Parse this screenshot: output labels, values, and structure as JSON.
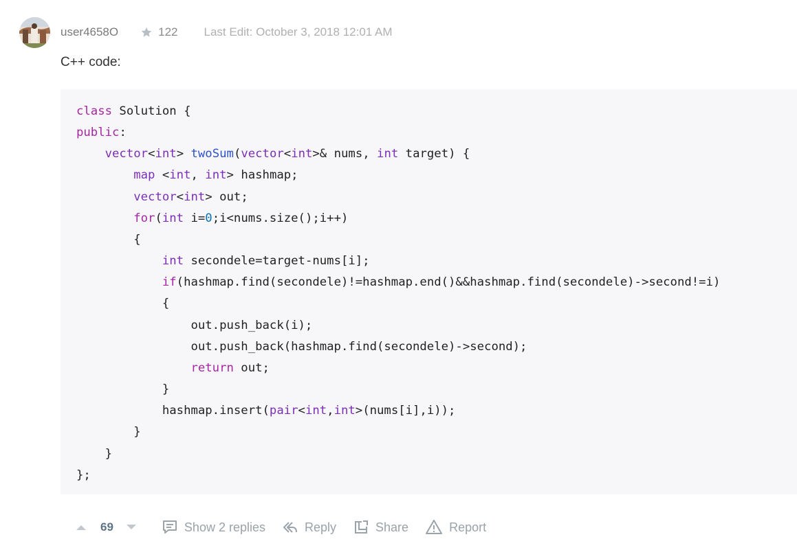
{
  "post": {
    "username": "user4658O",
    "reputation": "122",
    "last_edit": "Last Edit: October 3, 2018 12:01 AM",
    "intro_text": "C++ code:",
    "code_language": "C++",
    "code_lines": [
      "class Solution {",
      "public:",
      "    vector<int> twoSum(vector<int>& nums, int target) {",
      "        map <int, int> hashmap;",
      "        vector<int> out;",
      "        for(int i=0;i<nums.size();i++)",
      "        {",
      "            int secondele=target-nums[i];",
      "            if(hashmap.find(secondele)!=hashmap.end()&&hashmap.find(secondele)->second!=i)",
      "            {",
      "                out.push_back(i);",
      "                out.push_back(hashmap.find(secondele)->second);",
      "                return out;",
      "            }",
      "            hashmap.insert(pair<int,int>(nums[i],i));",
      "        }",
      "    }",
      "};"
    ]
  },
  "footer": {
    "vote_count": "69",
    "show_replies": "Show 2 replies",
    "reply": "Reply",
    "share": "Share",
    "report": "Report"
  },
  "icons": {
    "avatar": "user-avatar",
    "star": "star-icon",
    "upvote": "upvote-arrow-icon",
    "downvote": "downvote-arrow-icon",
    "replies": "comment-icon",
    "reply": "reply-arrow-icon",
    "share": "share-icon",
    "report": "warning-icon"
  },
  "colors": {
    "keyword": "#a626a4",
    "type": "#7c2eb8",
    "function": "#2c52c9",
    "number": "#0d72b5",
    "code_background": "#f7f7f9",
    "muted_text": "#9aa3a9"
  }
}
